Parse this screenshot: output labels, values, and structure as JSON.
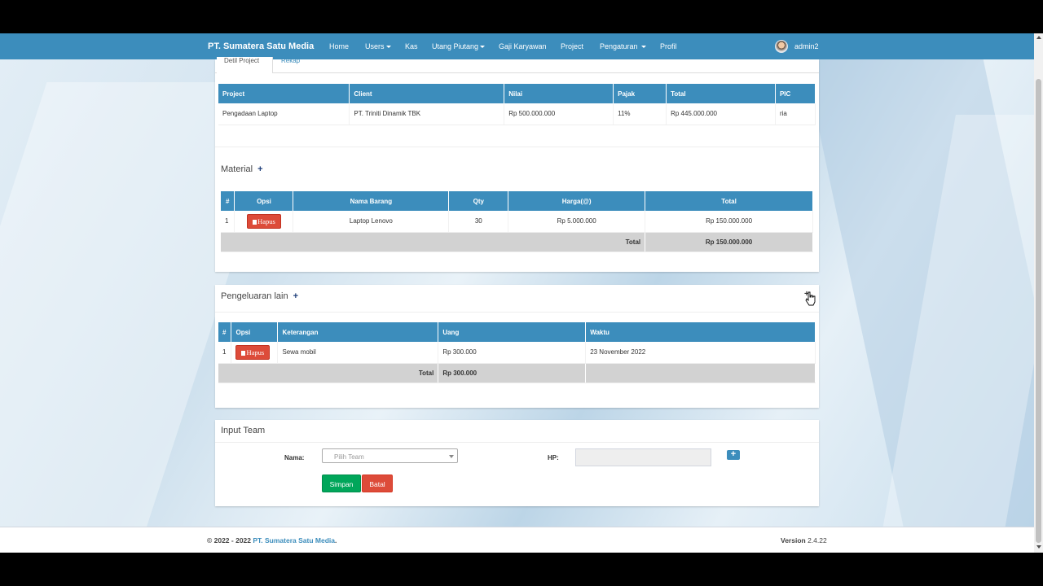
{
  "navbar": {
    "brand": "PT. Sumatera Satu Media",
    "items": [
      "Home",
      "Users",
      "Kas",
      "Utang Piutang",
      "Gaji Karyawan",
      "Project",
      "Pengaturan",
      "Profil"
    ],
    "user": "admin2"
  },
  "tabs": [
    "Detil Project",
    "Rekap"
  ],
  "project_table": {
    "headers": [
      "Project",
      "Client",
      "Nilai",
      "Pajak",
      "Total",
      "PIC"
    ],
    "row": [
      "Pengadaan Laptop",
      "PT. Triniti Dinamik TBK",
      "Rp 500.000.000",
      "11%",
      "Rp 445.000.000",
      "ria"
    ]
  },
  "material": {
    "title": "Material",
    "plus": "+",
    "headers": [
      "#",
      "Opsi",
      "Nama Barang",
      "Qty",
      "Harga(@)",
      "Total"
    ],
    "row": {
      "no": "1",
      "button": "Hapus",
      "nama": "Laptop Lenovo",
      "qty": "30",
      "harga": "Rp 5.000.000",
      "total": "Rp 150.000.000"
    },
    "total_label": "Total",
    "total_value": "Rp 150.000.000"
  },
  "pengeluaran": {
    "title": "Pengeluaran lain",
    "plus": "+",
    "corner_plus": "+",
    "headers": [
      "#",
      "Opsi",
      "Keterangan",
      "Uang",
      "Waktu"
    ],
    "row": {
      "no": "1",
      "button": "Hapus",
      "keterangan": "Sewa mobil",
      "uang": "Rp 300.000",
      "waktu": "23 November 2022"
    },
    "total_label": "Total",
    "total_value": "Rp 300.000"
  },
  "input_team": {
    "title": "Input Team",
    "nama_label": "Nama:",
    "nama_placeholder": "Pilih Team",
    "hp_label": "HP:",
    "add_label": "+",
    "simpan": "Simpan",
    "batal": "Batal"
  },
  "footer": {
    "copyright": "© 2022 - 2022",
    "company": "PT. Sumatera Satu Media",
    "version_label": "Version",
    "version": "2.4.22"
  },
  "colors": {
    "primary": "#3c8dbc",
    "danger": "#dd4b39",
    "success": "#00a65a"
  }
}
